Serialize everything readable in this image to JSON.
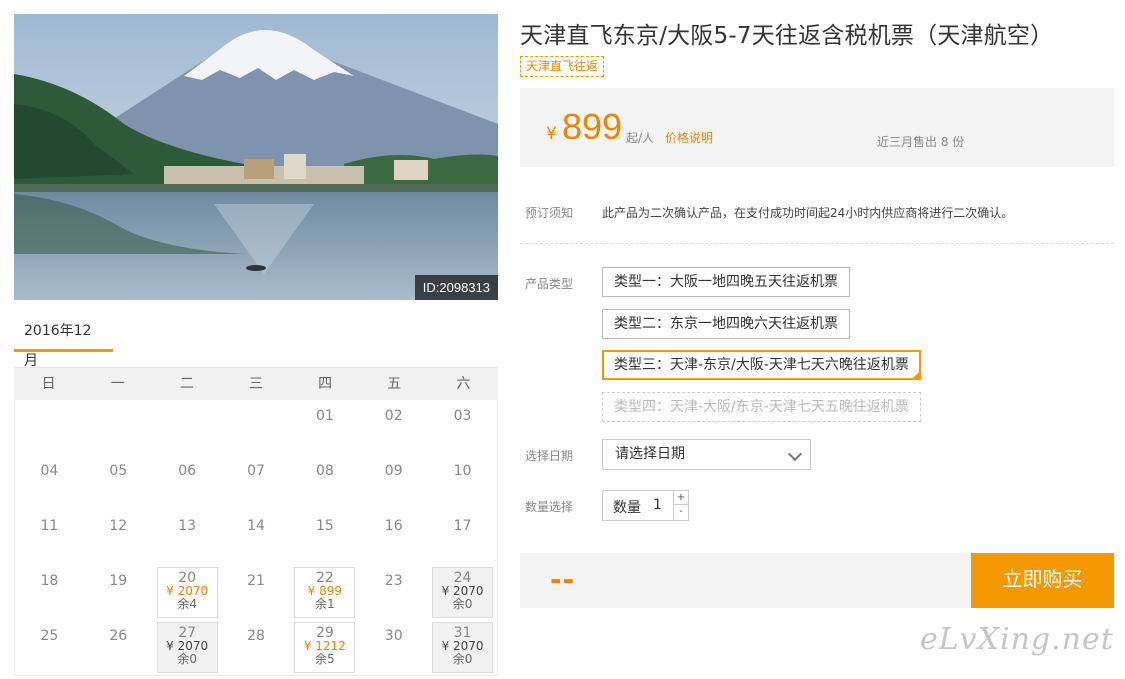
{
  "photo": {
    "id_label": "ID:2098313"
  },
  "calendar": {
    "month": "2016年12月",
    "weekdays": [
      "日",
      "一",
      "二",
      "三",
      "四",
      "五",
      "六"
    ],
    "weeks": [
      [
        {
          "d": ""
        },
        {
          "d": ""
        },
        {
          "d": ""
        },
        {
          "d": ""
        },
        {
          "d": "01"
        },
        {
          "d": "02"
        },
        {
          "d": "03"
        }
      ],
      [
        {
          "d": "04"
        },
        {
          "d": "05"
        },
        {
          "d": "06"
        },
        {
          "d": "07"
        },
        {
          "d": "08"
        },
        {
          "d": "09"
        },
        {
          "d": "10"
        }
      ],
      [
        {
          "d": "11"
        },
        {
          "d": "12"
        },
        {
          "d": "13"
        },
        {
          "d": "14"
        },
        {
          "d": "15"
        },
        {
          "d": "16"
        },
        {
          "d": "17"
        }
      ],
      [
        {
          "d": "18"
        },
        {
          "d": "19"
        },
        {
          "d": "20",
          "price": "¥ 2070",
          "remain": "余4",
          "style": "available"
        },
        {
          "d": "21"
        },
        {
          "d": "22",
          "price": "¥ 899",
          "remain": "余1",
          "style": "available"
        },
        {
          "d": "23"
        },
        {
          "d": "24",
          "price": "¥ 2070",
          "remain": "余0",
          "style": "soldout"
        }
      ],
      [
        {
          "d": "25"
        },
        {
          "d": "26"
        },
        {
          "d": "27",
          "price": "¥ 2070",
          "remain": "余0",
          "style": "soldout"
        },
        {
          "d": "28"
        },
        {
          "d": "29",
          "price": "¥ 1212",
          "remain": "余5",
          "style": "available"
        },
        {
          "d": "30"
        },
        {
          "d": "31",
          "price": "¥ 2070",
          "remain": "余0",
          "style": "soldout"
        }
      ]
    ]
  },
  "product": {
    "title": "天津直飞东京/大阪5-7天往返含税机票（天津航空）",
    "tag": "天津直飞往返",
    "price": {
      "currency": "¥",
      "amount": "899",
      "unit": "起/人",
      "explain_link": "价格说明",
      "sold": "近三月售出 8 份"
    },
    "notice": {
      "label": "预订须知",
      "text": "此产品为二次确认产品，在支付成功时间起24小时内供应商将进行二次确认。"
    },
    "types": {
      "label": "产品类型",
      "options": [
        {
          "text": "类型一：大阪一地四晚五天往返机票",
          "state": "normal"
        },
        {
          "text": "类型二：东京一地四晚六天往返机票",
          "state": "normal"
        },
        {
          "text": "类型三：天津-东京/大阪-天津七天六晚往返机票",
          "state": "selected"
        },
        {
          "text": "类型四：天津-大阪/东京-天津七天五晚往返机票",
          "state": "disabled"
        }
      ]
    },
    "date": {
      "label": "选择日期",
      "placeholder": "请选择日期"
    },
    "quantity": {
      "label": "数量选择",
      "field_label": "数量",
      "value": "1",
      "plus": "+",
      "minus": "-"
    },
    "total": "--",
    "buy_label": "立即购买"
  },
  "watermark": "eLvXing.net",
  "colors": {
    "accent": "#f39800",
    "price": "#f08300"
  }
}
